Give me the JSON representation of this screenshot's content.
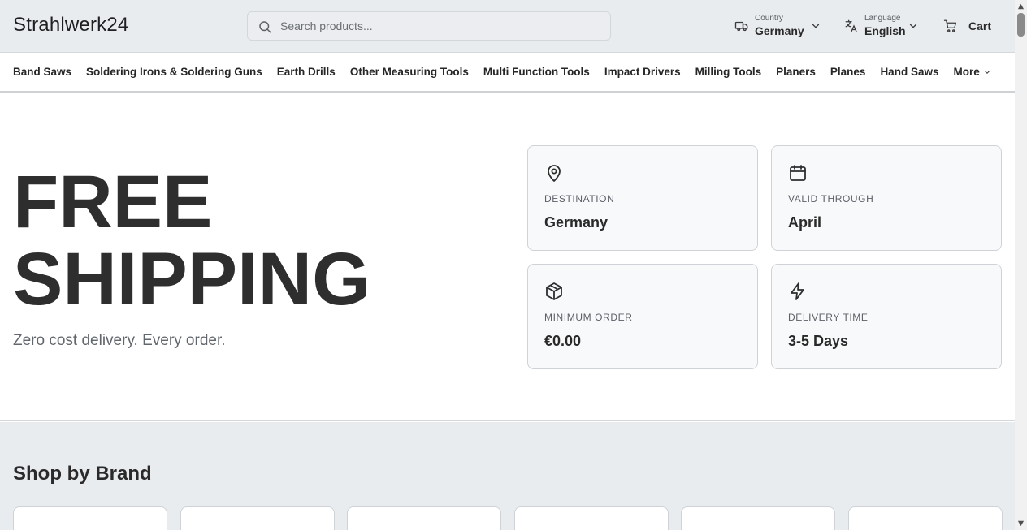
{
  "header": {
    "logo": "Strahlwerk24",
    "search": {
      "placeholder": "Search products..."
    },
    "country": {
      "label": "Country",
      "value": "Germany"
    },
    "language": {
      "label": "Language",
      "value": "English"
    },
    "cart_label": "Cart"
  },
  "categories": {
    "items": [
      "Band Saws",
      "Soldering Irons & Soldering Guns",
      "Earth Drills",
      "Other Measuring Tools",
      "Multi Function Tools",
      "Impact Drivers",
      "Milling Tools",
      "Planers",
      "Planes",
      "Hand Saws"
    ],
    "more_label": "More"
  },
  "hero": {
    "title_line1": "FREE",
    "title_line2": "SHIPPING",
    "subtitle": "Zero cost delivery. Every order.",
    "cards": [
      {
        "icon": "map-pin-icon",
        "label": "DESTINATION",
        "value": "Germany"
      },
      {
        "icon": "calendar-icon",
        "label": "VALID THROUGH",
        "value": "April"
      },
      {
        "icon": "package-icon",
        "label": "MINIMUM ORDER",
        "value": "€0.00"
      },
      {
        "icon": "lightning-icon",
        "label": "DELIVERY TIME",
        "value": "3-5 Days"
      }
    ]
  },
  "brands": {
    "title": "Shop by Brand"
  },
  "colors": {
    "header_bg": "#e9ecef",
    "text": "#2e2e2e",
    "muted": "#62676d",
    "card_bg": "#f8f9fa",
    "border": "#cfd3d7"
  }
}
